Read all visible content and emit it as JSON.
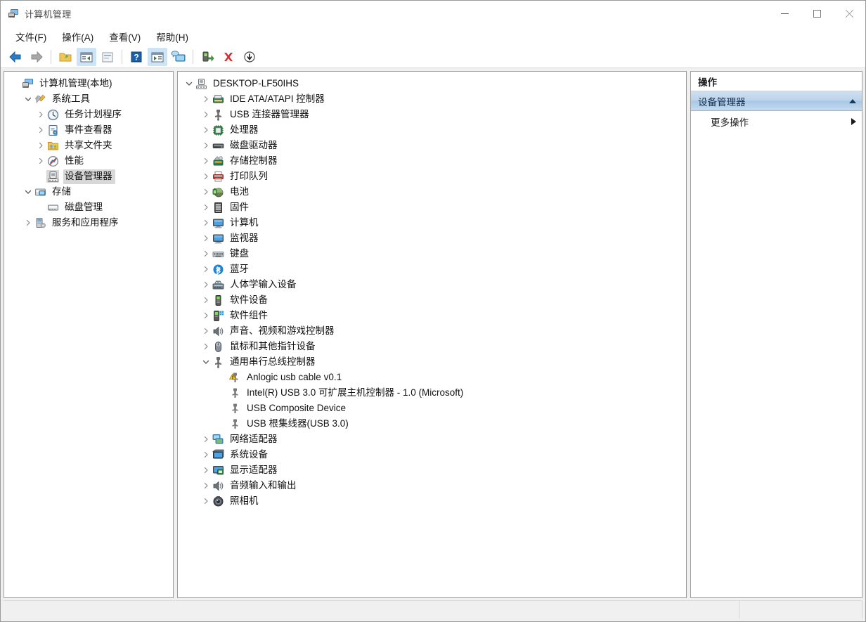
{
  "window": {
    "title": "计算机管理",
    "title_icon": "computer-management-icon",
    "buttons": {
      "minimize": "minimize-icon",
      "maximize": "maximize-icon",
      "close": "close-icon"
    }
  },
  "menubar": {
    "items": [
      {
        "label": "文件(F)",
        "name": "menu-file"
      },
      {
        "label": "操作(A)",
        "name": "menu-action"
      },
      {
        "label": "查看(V)",
        "name": "menu-view"
      },
      {
        "label": "帮助(H)",
        "name": "menu-help"
      }
    ]
  },
  "toolbar": {
    "items": [
      {
        "name": "back-button",
        "icon": "arrow-left-icon",
        "active": false
      },
      {
        "name": "forward-button",
        "icon": "arrow-right-icon",
        "active": false
      },
      {
        "name": "separator-1",
        "icon": "separator",
        "active": false
      },
      {
        "name": "up-folder-button",
        "icon": "folder-up-icon",
        "active": false
      },
      {
        "name": "show-hide-tree-button",
        "icon": "console-tree-icon",
        "active": true
      },
      {
        "name": "properties-button",
        "icon": "properties-icon",
        "active": false
      },
      {
        "name": "separator-2",
        "icon": "separator",
        "active": false
      },
      {
        "name": "help-button",
        "icon": "help-icon",
        "active": false
      },
      {
        "name": "show-hide-action-pane-button",
        "icon": "action-pane-icon",
        "active": true
      },
      {
        "name": "scan-hardware-button",
        "icon": "scan-computer-icon",
        "active": false
      },
      {
        "name": "separator-3",
        "icon": "separator",
        "active": false
      },
      {
        "name": "update-driver-button",
        "icon": "update-driver-icon",
        "active": false
      },
      {
        "name": "uninstall-device-button",
        "icon": "uninstall-x-icon",
        "active": false
      },
      {
        "name": "disable-device-button",
        "icon": "disable-arrow-down-icon",
        "active": false
      }
    ]
  },
  "console_tree": {
    "root": {
      "label": "计算机管理(本地)",
      "icon": "computer-management-icon",
      "indent": 0,
      "chevron": "none",
      "selected": false
    },
    "items": [
      {
        "label": "系统工具",
        "icon": "system-tools-icon",
        "indent": 1,
        "chevron": "down",
        "selected": false
      },
      {
        "label": "任务计划程序",
        "icon": "task-scheduler-icon",
        "indent": 2,
        "chevron": "right",
        "selected": false
      },
      {
        "label": "事件查看器",
        "icon": "event-viewer-icon",
        "indent": 2,
        "chevron": "right",
        "selected": false
      },
      {
        "label": "共享文件夹",
        "icon": "shared-folders-icon",
        "indent": 2,
        "chevron": "right",
        "selected": false
      },
      {
        "label": "性能",
        "icon": "performance-icon",
        "indent": 2,
        "chevron": "right",
        "selected": false
      },
      {
        "label": "设备管理器",
        "icon": "device-manager-icon",
        "indent": 2,
        "chevron": "none",
        "selected": true
      },
      {
        "label": "存储",
        "icon": "storage-icon",
        "indent": 1,
        "chevron": "down",
        "selected": false
      },
      {
        "label": "磁盘管理",
        "icon": "disk-management-icon",
        "indent": 2,
        "chevron": "none",
        "selected": false
      },
      {
        "label": "服务和应用程序",
        "icon": "services-apps-icon",
        "indent": 1,
        "chevron": "right",
        "selected": false
      }
    ]
  },
  "device_tree": {
    "root": {
      "label": "DESKTOP-LF50IHS",
      "icon": "computer-root-icon",
      "indent": 0,
      "chevron": "down"
    },
    "items": [
      {
        "label": "IDE ATA/ATAPI 控制器",
        "icon": "ide-controller-icon",
        "indent": 1,
        "chevron": "right",
        "warning": false
      },
      {
        "label": "USB 连接器管理器",
        "icon": "usb-icon",
        "indent": 1,
        "chevron": "right",
        "warning": false
      },
      {
        "label": "处理器",
        "icon": "processor-icon",
        "indent": 1,
        "chevron": "right",
        "warning": false
      },
      {
        "label": "磁盘驱动器",
        "icon": "disk-drive-icon",
        "indent": 1,
        "chevron": "right",
        "warning": false
      },
      {
        "label": "存储控制器",
        "icon": "storage-controller-icon",
        "indent": 1,
        "chevron": "right",
        "warning": false
      },
      {
        "label": "打印队列",
        "icon": "printer-icon",
        "indent": 1,
        "chevron": "right",
        "warning": false
      },
      {
        "label": "电池",
        "icon": "battery-icon",
        "indent": 1,
        "chevron": "right",
        "warning": false
      },
      {
        "label": "固件",
        "icon": "firmware-icon",
        "indent": 1,
        "chevron": "right",
        "warning": false
      },
      {
        "label": "计算机",
        "icon": "computer-icon",
        "indent": 1,
        "chevron": "right",
        "warning": false
      },
      {
        "label": "监视器",
        "icon": "monitor-icon",
        "indent": 1,
        "chevron": "right",
        "warning": false
      },
      {
        "label": "键盘",
        "icon": "keyboard-icon",
        "indent": 1,
        "chevron": "right",
        "warning": false
      },
      {
        "label": "蓝牙",
        "icon": "bluetooth-icon",
        "indent": 1,
        "chevron": "right",
        "warning": false
      },
      {
        "label": "人体学输入设备",
        "icon": "hid-icon",
        "indent": 1,
        "chevron": "right",
        "warning": false
      },
      {
        "label": "软件设备",
        "icon": "software-device-icon",
        "indent": 1,
        "chevron": "right",
        "warning": false
      },
      {
        "label": "软件组件",
        "icon": "software-component-icon",
        "indent": 1,
        "chevron": "right",
        "warning": false
      },
      {
        "label": "声音、视频和游戏控制器",
        "icon": "sound-icon",
        "indent": 1,
        "chevron": "right",
        "warning": false
      },
      {
        "label": "鼠标和其他指针设备",
        "icon": "mouse-icon",
        "indent": 1,
        "chevron": "right",
        "warning": false
      },
      {
        "label": "通用串行总线控制器",
        "icon": "usb-icon",
        "indent": 1,
        "chevron": "down",
        "warning": false
      },
      {
        "label": "Anlogic usb cable v0.1",
        "icon": "usb-device-icon",
        "indent": 2,
        "chevron": "none",
        "warning": true
      },
      {
        "label": "Intel(R) USB 3.0 可扩展主机控制器 - 1.0 (Microsoft)",
        "icon": "usb-device-icon",
        "indent": 2,
        "chevron": "none",
        "warning": false
      },
      {
        "label": "USB Composite Device",
        "icon": "usb-device-icon",
        "indent": 2,
        "chevron": "none",
        "warning": false
      },
      {
        "label": "USB 根集线器(USB 3.0)",
        "icon": "usb-device-icon",
        "indent": 2,
        "chevron": "none",
        "warning": false
      },
      {
        "label": "网络适配器",
        "icon": "network-adapter-icon",
        "indent": 1,
        "chevron": "right",
        "warning": false
      },
      {
        "label": "系统设备",
        "icon": "system-device-icon",
        "indent": 1,
        "chevron": "right",
        "warning": false
      },
      {
        "label": "显示适配器",
        "icon": "display-adapter-icon",
        "indent": 1,
        "chevron": "right",
        "warning": false
      },
      {
        "label": "音频输入和输出",
        "icon": "audio-io-icon",
        "indent": 1,
        "chevron": "right",
        "warning": false
      },
      {
        "label": "照相机",
        "icon": "camera-icon",
        "indent": 1,
        "chevron": "right",
        "warning": false
      }
    ]
  },
  "actions_pane": {
    "header": "操作",
    "group": {
      "label": "设备管理器",
      "collapse_icon": "triangle-up-icon"
    },
    "items": [
      {
        "label": "更多操作",
        "submenu_icon": "triangle-right-icon"
      }
    ]
  },
  "statusbar": {
    "cells": [
      "",
      "",
      ""
    ]
  },
  "colors": {
    "accent_selection": "#d8d8d8",
    "action_group_bg": "#b9d2ea",
    "warning_yellow": "#f5c518",
    "close_hover": "#e81123",
    "toolbar_active": "#cce4f7"
  }
}
